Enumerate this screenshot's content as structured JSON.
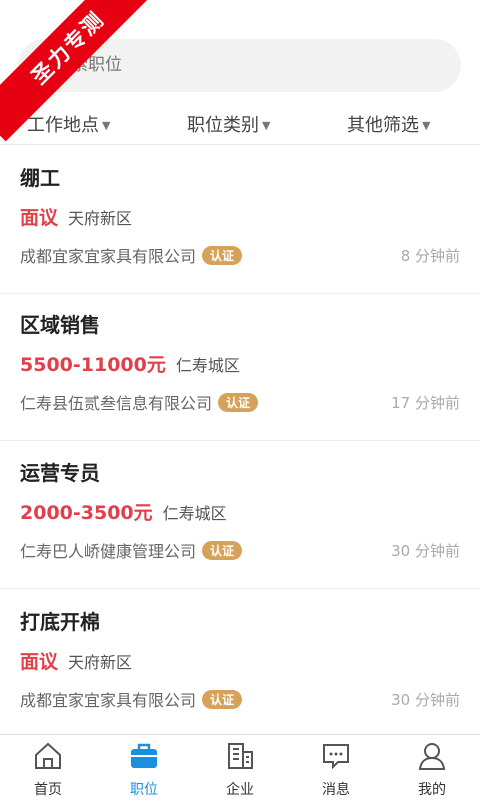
{
  "ribbon": {
    "text": "圣力专测",
    "color": "#e60012"
  },
  "search": {
    "placeholder": "搜索职位"
  },
  "filters": [
    {
      "label": "工作地点"
    },
    {
      "label": "职位类别"
    },
    {
      "label": "其他筛选"
    }
  ],
  "jobs": [
    {
      "title": "绷工",
      "salary": "面议",
      "area": "天府新区",
      "company": "成都宜家宜家具有限公司",
      "badge": "认证",
      "time": "8 分钟前"
    },
    {
      "title": "区域销售",
      "salary": "5500-11000元",
      "area": "仁寿城区",
      "company": "仁寿县伍贰叁信息有限公司",
      "badge": "认证",
      "time": "17 分钟前"
    },
    {
      "title": "运营专员",
      "salary": "2000-3500元",
      "area": "仁寿城区",
      "company": "仁寿巴人峤健康管理公司",
      "badge": "认证",
      "time": "30 分钟前"
    },
    {
      "title": "打底开棉",
      "salary": "面议",
      "area": "天府新区",
      "company": "成都宜家宜家具有限公司",
      "badge": "认证",
      "time": "30 分钟前"
    }
  ],
  "tabbar": {
    "tabs": [
      {
        "label": "首页",
        "icon": "home-icon"
      },
      {
        "label": "职位",
        "icon": "briefcase-icon",
        "active": true
      },
      {
        "label": "企业",
        "icon": "building-icon"
      },
      {
        "label": "消息",
        "icon": "message-icon"
      },
      {
        "label": "我的",
        "icon": "user-icon"
      }
    ],
    "active_color": "#1a8fe0"
  },
  "colors": {
    "salary": "#e0404a",
    "badge": "#d6a25a"
  }
}
